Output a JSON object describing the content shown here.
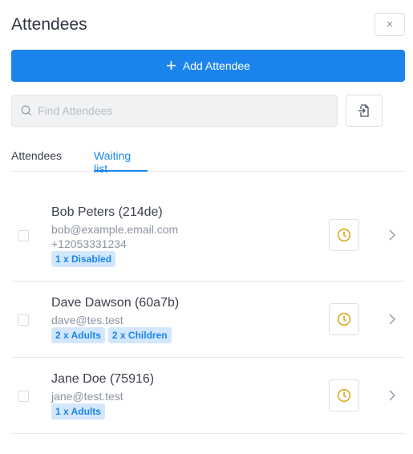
{
  "header": {
    "title": "Attendees",
    "close_label": "×"
  },
  "add_button": {
    "icon": "+",
    "label": "Add Attendee"
  },
  "search": {
    "placeholder": "Find Attendees",
    "value": ""
  },
  "import_button": {
    "icon": "file-import-icon"
  },
  "tabs": [
    {
      "label": "Attendees",
      "active": false
    },
    {
      "label": "Waiting list",
      "active": true
    }
  ],
  "colors": {
    "accent": "#1b84ec",
    "badge_bg": "#d3e7fc",
    "clock": "#d4ac1a"
  },
  "attendees": [
    {
      "name": "Bob Peters (214de)",
      "email": "bob@example.email.com",
      "phone": "+12053331234",
      "badges": [
        "1 x Disabled"
      ]
    },
    {
      "name": "Dave Dawson (60a7b)",
      "email": "dave@tes.test",
      "badges": [
        "2 x Adults",
        "2 x Children"
      ]
    },
    {
      "name": "Jane Doe (75916)",
      "email": "jane@test.test",
      "badges": [
        "1 x Adults"
      ]
    }
  ]
}
